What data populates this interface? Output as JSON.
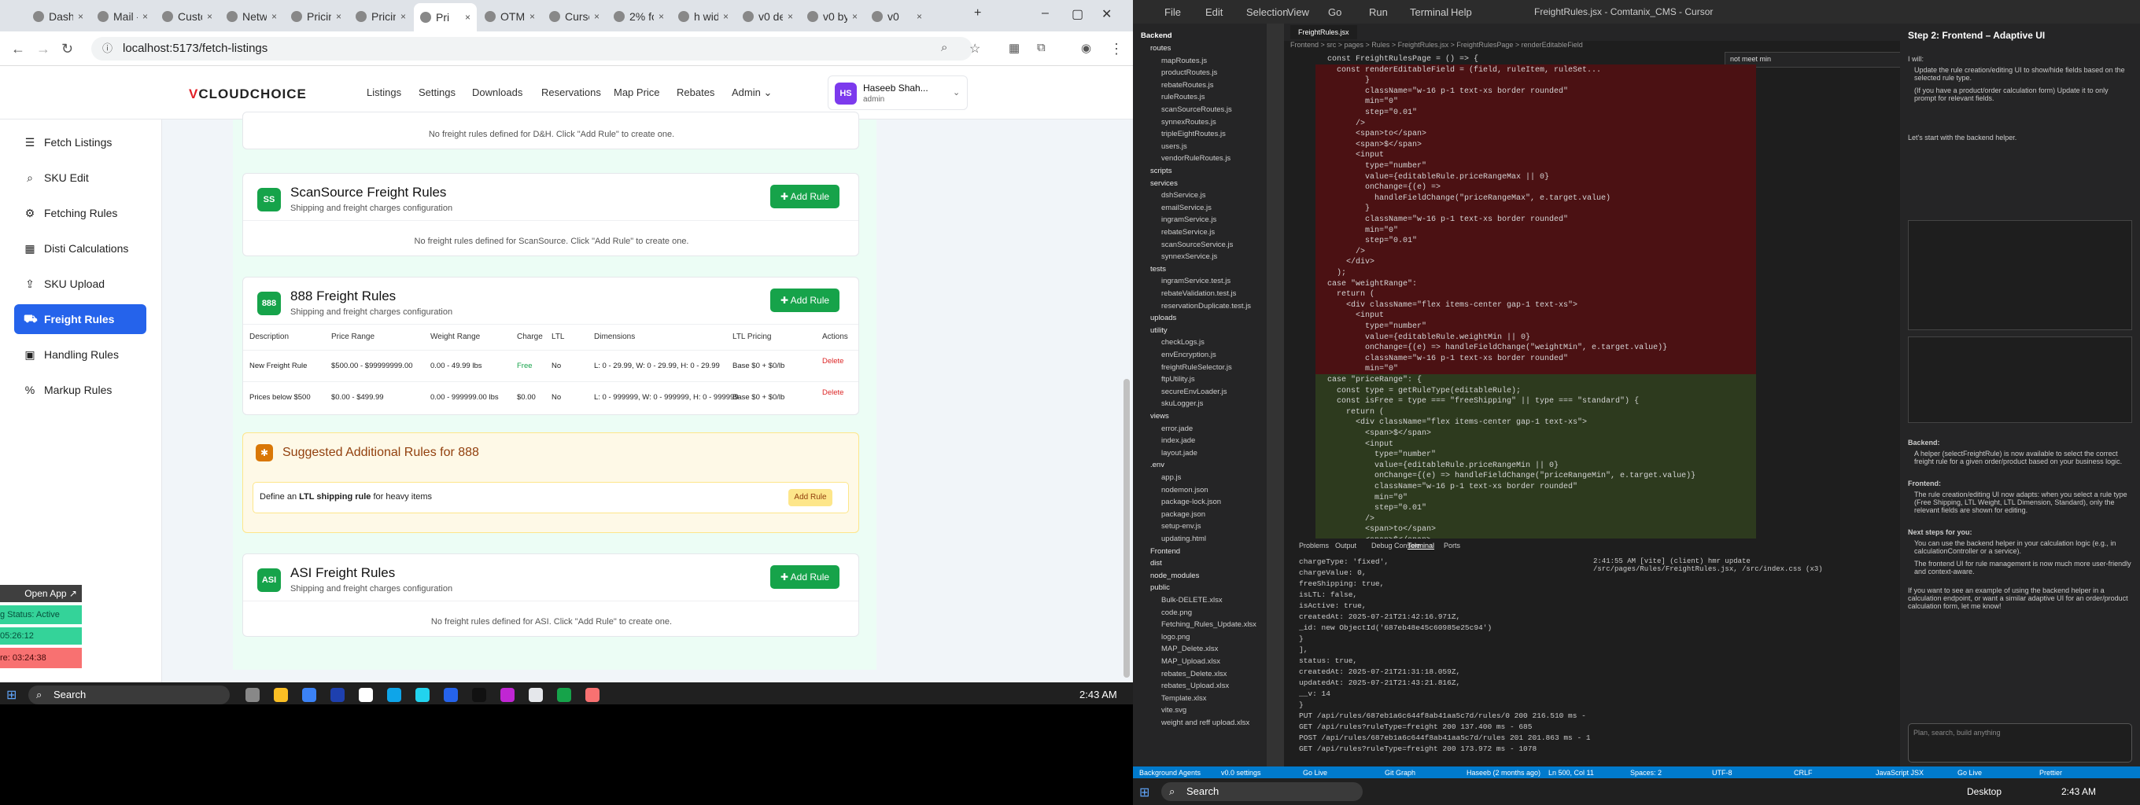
{
  "browser": {
    "tabs": [
      "Dashb",
      "Mail -",
      "Custo",
      "Netwo",
      "Pricing",
      "Pricing",
      "Pri",
      "OTMS",
      "Cursor",
      "2% for",
      "h widt",
      "v0 dev",
      "v0 by",
      "v0"
    ],
    "url": "localhost:5173/fetch-listings"
  },
  "app": {
    "logo_a": "V",
    "logo_b": "CLOUDCHOICE",
    "menu": [
      "Listings",
      "Settings",
      "Downloads",
      "Reservations",
      "Map Price",
      "Rebates",
      "Admin"
    ],
    "user_initials": "HS",
    "user_name": "Haseeb Shah...",
    "user_role": "admin"
  },
  "sidebar": {
    "items": [
      {
        "label": "Fetch Listings",
        "icon": "list-icon"
      },
      {
        "label": "SKU Edit",
        "icon": "search-icon"
      },
      {
        "label": "Fetching Rules",
        "icon": "settings-icon"
      },
      {
        "label": "Disti Calculations",
        "icon": "calculator-icon"
      },
      {
        "label": "SKU Upload",
        "icon": "upload-icon"
      },
      {
        "label": "Freight Rules",
        "icon": "truck-icon"
      },
      {
        "label": "Handling Rules",
        "icon": "package-icon"
      },
      {
        "label": "Markup Rules",
        "icon": "percent-icon"
      }
    ]
  },
  "cards": {
    "dh_empty": "No freight rules defined for D&H. Click \"Add Rule\" to create one.",
    "scansource": {
      "badge": "SS",
      "title": "ScanSource Freight Rules",
      "subtitle": "Shipping and freight charges configuration",
      "button": "Add Rule",
      "empty": "No freight rules defined for ScanSource. Click \"Add Rule\" to create one."
    },
    "c888": {
      "badge": "888",
      "title": "888 Freight Rules",
      "subtitle": "Shipping and freight charges configuration",
      "button": "Add Rule",
      "headers": [
        "Description",
        "Price Range",
        "Weight Range",
        "Charge",
        "LTL",
        "Dimensions",
        "LTL Pricing",
        "Actions"
      ],
      "rows": [
        {
          "desc": "New Freight Rule",
          "price": "$500.00 - $99999999.00",
          "weight": "0.00 - 49.99 lbs",
          "charge": "Free",
          "ltl": "No",
          "dims": "L: 0 - 29.99, W: 0 - 29.99, H: 0 - 29.99",
          "ltlp": "Base $0 + $0/lb",
          "action": "Delete"
        },
        {
          "desc": "Prices below $500",
          "price": "$0.00 - $499.99",
          "weight": "0.00 - 999999.00 lbs",
          "charge": "$0.00",
          "ltl": "No",
          "dims": "L: 0 - 999999, W: 0 - 999999, H: 0 - 999999",
          "ltlp": "Base $0 + $0/lb",
          "action": "Delete"
        }
      ]
    },
    "suggest": {
      "title": "Suggested Additional Rules for 888",
      "text_pre": "Define an ",
      "text_bold": "LTL shipping rule",
      "text_post": " for heavy items",
      "button": "Add Rule"
    },
    "asi": {
      "badge": "ASI",
      "title": "ASI Freight Rules",
      "subtitle": "Shipping and freight charges configuration",
      "button": "Add Rule",
      "empty": "No freight rules defined for ASI. Click \"Add Rule\" to create one."
    }
  },
  "widget": {
    "open": "Open App ↗",
    "status": "g Status: Active",
    "t1": "05:26:12",
    "t2": "re: 03:24:38"
  },
  "taskbar": {
    "search": "Search",
    "time": "2:43 AM"
  },
  "vscode": {
    "title": "FreightRules.jsx - Comtanix_CMS - Cursor",
    "menu": [
      "File",
      "Edit",
      "Selection",
      "View",
      "Go",
      "Run",
      "Terminal",
      "Help"
    ],
    "breadcrumb": "Frontend > src > pages > Rules > FreightRules.jsx > FreightRulesPage > renderEditableField",
    "find": "not meet min",
    "explorer_title": "Backend",
    "files": [
      "routes",
      "mapRoutes.js",
      "productRoutes.js",
      "rebateRoutes.js",
      "ruleRoutes.js",
      "scanSourceRoutes.js",
      "synnexRoutes.js",
      "tripleEightRoutes.js",
      "users.js",
      "vendorRuleRoutes.js",
      "scripts",
      "services",
      "dshService.js",
      "emailService.js",
      "ingramService.js",
      "rebateService.js",
      "scanSourceService.js",
      "synnexService.js",
      "tests",
      "ingramService.test.js",
      "rebateValidation.test.js",
      "reservationDuplicate.test.js",
      "uploads",
      "utility",
      "checkLogs.js",
      "envEncryption.js",
      "freightRuleSelector.js",
      "ftpUtility.js",
      "secureEnvLoader.js",
      "skuLogger.js",
      "views",
      "error.jade",
      "index.jade",
      "layout.jade",
      ".env",
      "app.js",
      "nodemon.json",
      "package-lock.json",
      "package.json",
      "setup-env.js",
      "updating.html",
      "Frontend",
      "dist",
      "node_modules",
      "public",
      "Bulk-DELETE.xlsx",
      "code.png",
      "Fetching_Rules_Update.xlsx",
      "logo.png",
      "MAP_Delete.xlsx",
      "MAP_Upload.xlsx",
      "rebates_Delete.xlsx",
      "rebates_Upload.xlsx",
      "Template.xlsx",
      "vite.svg",
      "weight and reff upload.xlsx"
    ],
    "code": [
      "const FreightRulesPage = () => {",
      "  const renderEditableField = (field, ruleItem, ruleSet...",
      "        }",
      "        className=\"w-16 p-1 text-xs border rounded\"",
      "        min=\"0\"",
      "        step=\"0.01\"",
      "      />",
      "      <span>to</span>",
      "      <span>$</span>",
      "      <input",
      "        type=\"number\"",
      "        value={editableRule.priceRangeMax || 0}",
      "        onChange={(e) =>",
      "          handleFieldChange(\"priceRangeMax\", e.target.value)",
      "        }",
      "        className=\"w-16 p-1 text-xs border rounded\"",
      "        min=\"0\"",
      "        step=\"0.01\"",
      "      />",
      "    </div>",
      "  );",
      "case \"weightRange\":",
      "  return (",
      "    <div className=\"flex items-center gap-1 text-xs\">",
      "      <input",
      "        type=\"number\"",
      "        value={editableRule.weightMin || 0}",
      "        onChange={(e) => handleFieldChange(\"weightMin\", e.target.value)}",
      "        className=\"w-16 p-1 text-xs border rounded\"",
      "        min=\"0\"",
      "case \"priceRange\": {",
      "  const type = getRuleType(editableRule);",
      "  const isFree = type === \"freeShipping\" || type === \"standard\") {",
      "    return (",
      "      <div className=\"flex items-center gap-1 text-xs\">",
      "        <span>$</span>",
      "        <input",
      "          type=\"number\"",
      "          value={editableRule.priceRangeMin || 0}",
      "          onChange={(e) => handleFieldChange(\"priceRangeMin\", e.target.value)}",
      "          className=\"w-16 p-1 text-xs border rounded\"",
      "          min=\"0\"",
      "          step=\"0.01\"",
      "        />",
      "        <span>to</span>",
      "        <span>$</span>"
    ],
    "terminal_tabs": [
      "Problems",
      "Output",
      "Debug Console",
      "Terminal",
      "Ports"
    ],
    "terminal": [
      "    chargeType: 'fixed',",
      "    chargeValue: 0,",
      "    freeShipping: true,",
      "    isLTL: false,",
      "    isActive: true,",
      "    createdAt: 2025-07-21T21:42:16.971Z,",
      "    _id: new ObjectId('687eb48e45c60985e25c94')",
      "  }",
      "],",
      "status: true,",
      "createdAt: 2025-07-21T21:31:18.059Z,",
      "updatedAt: 2025-07-21T21:43:21.816Z,",
      "__v: 14",
      "}",
      "PUT /api/rules/687eb1a6c644f8ab41aa5c7d/rules/0 200 216.510 ms - 684",
      "GET /api/rules?ruleType=freight 200 137.400 ms - 685",
      "POST /api/rules/687eb1a6c644f8ab41aa5c7d/rules 201 201.863 ms - 1075",
      "GET /api/rules?ruleType=freight 200 173.972 ms - 1078"
    ],
    "vite_log": "2:41:55 AM [vite] (client) hmr update /src/pages/Rules/FreightRules.jsx, /src/index.css (x3)",
    "chat": {
      "heading": "Step 2: Frontend – Adaptive UI",
      "intro": "I will:",
      "bullets": [
        "Update the rule creation/editing UI to show/hide fields based on the selected rule type.",
        "(If you have a product/order calculation form) Update it to only prompt for relevant fields."
      ],
      "start": "Let's start with the backend helper.",
      "backend_title": "Backend:",
      "backend": "A helper (selectFreightRule) is now available to select the correct freight rule for a given order/product based on your business logic.",
      "frontend_title": "Frontend:",
      "frontend": "The rule creation/editing UI now adapts: when you select a rule type (Free Shipping, LTL Weight, LTL Dimension, Standard), only the relevant fields are shown for editing.",
      "next_title": "Next steps for you:",
      "next": [
        "You can use the backend helper in your calculation logic (e.g., in calculationController or a service).",
        "The frontend UI for rule management is now much more user-friendly and context-aware."
      ],
      "outro": "If you want to see an example of using the backend helper in a calculation endpoint, or want a similar adaptive UI for an order/product calculation form, let me know!",
      "input_placeholder": "Plan, search, build anything"
    },
    "status": [
      "Background Agents",
      "v0.0 settings",
      "Go Live",
      "Git Graph",
      "Haseeb (2 months ago)",
      "Ln 500, Col 11",
      "Spaces: 2",
      "UTF-8",
      "CRLF",
      "JavaScript JSX",
      "Go Live",
      "Prettier"
    ]
  },
  "taskbar2": {
    "search": "Search",
    "desktop": "Desktop",
    "time": "2:43 AM"
  }
}
